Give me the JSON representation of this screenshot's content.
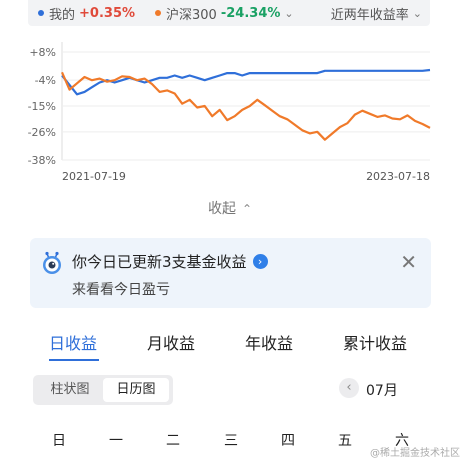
{
  "legend": {
    "items": [
      {
        "name": "我的",
        "value": "+0.35%",
        "color": "#2f6fd9",
        "value_color": "#e04a3a"
      },
      {
        "name": "沪深300",
        "value": "-24.34%",
        "color": "#f07a2a",
        "value_color": "#1aa164"
      }
    ],
    "period": "近两年收益率"
  },
  "chart_data": {
    "type": "line",
    "x": [
      "2021-07-19",
      "2023-07-18"
    ],
    "xlabel": "",
    "ylabel": "",
    "y_ticks": [
      "+8%",
      "-4%",
      "-15%",
      "-26%",
      "-38%"
    ],
    "ylim": [
      -38,
      8
    ],
    "series": [
      {
        "name": "我的",
        "color": "#2f6fd9",
        "values": [
          -2,
          -6,
          -10,
          -9,
          -7,
          -5,
          -4,
          -5,
          -4,
          -3,
          -4,
          -5,
          -4,
          -3,
          -3,
          -2,
          -3,
          -2,
          -3,
          -4,
          -3,
          -2,
          -1,
          -1,
          -2,
          -1,
          -1,
          -1,
          -1,
          -1,
          -1,
          -1,
          -1,
          -1,
          -1,
          0,
          0,
          0,
          0,
          0,
          0,
          0,
          0,
          0,
          0,
          0,
          0,
          0,
          0,
          0.35
        ]
      },
      {
        "name": "沪深300",
        "color": "#f07a2a",
        "values": [
          -1,
          -8,
          -5,
          -3,
          -4,
          -3,
          -5,
          -4,
          -2,
          -3,
          -4,
          -3,
          -6,
          -9,
          -8,
          -10,
          -14,
          -12,
          -16,
          -15,
          -19,
          -17,
          -21,
          -19,
          -17,
          -15,
          -12,
          -15,
          -17,
          -19,
          -21,
          -23,
          -25,
          -27,
          -26,
          -29,
          -27,
          -24,
          -22,
          -19,
          -17,
          -18,
          -20,
          -19,
          -20,
          -21,
          -19,
          -21,
          -23,
          -24.34
        ]
      }
    ],
    "grid": true,
    "legend": "top"
  },
  "collapse": {
    "label": "收起",
    "icon": "chevron-up-icon"
  },
  "notice": {
    "title": "你今日已更新3支基金收益",
    "subtitle": "来看看今日盈亏",
    "go_glyph": "›",
    "close_glyph": "✕"
  },
  "tabs": [
    "日收益",
    "月收益",
    "年收益",
    "累计收益"
  ],
  "view_toggle": {
    "options": [
      "柱状图",
      "日历图"
    ],
    "selected": "日历图"
  },
  "month": {
    "prev_glyph": "‹",
    "label": "07月"
  },
  "weekdays": [
    "日",
    "一",
    "二",
    "三",
    "四",
    "五",
    "六"
  ],
  "watermark": "@稀土掘金技术社区"
}
